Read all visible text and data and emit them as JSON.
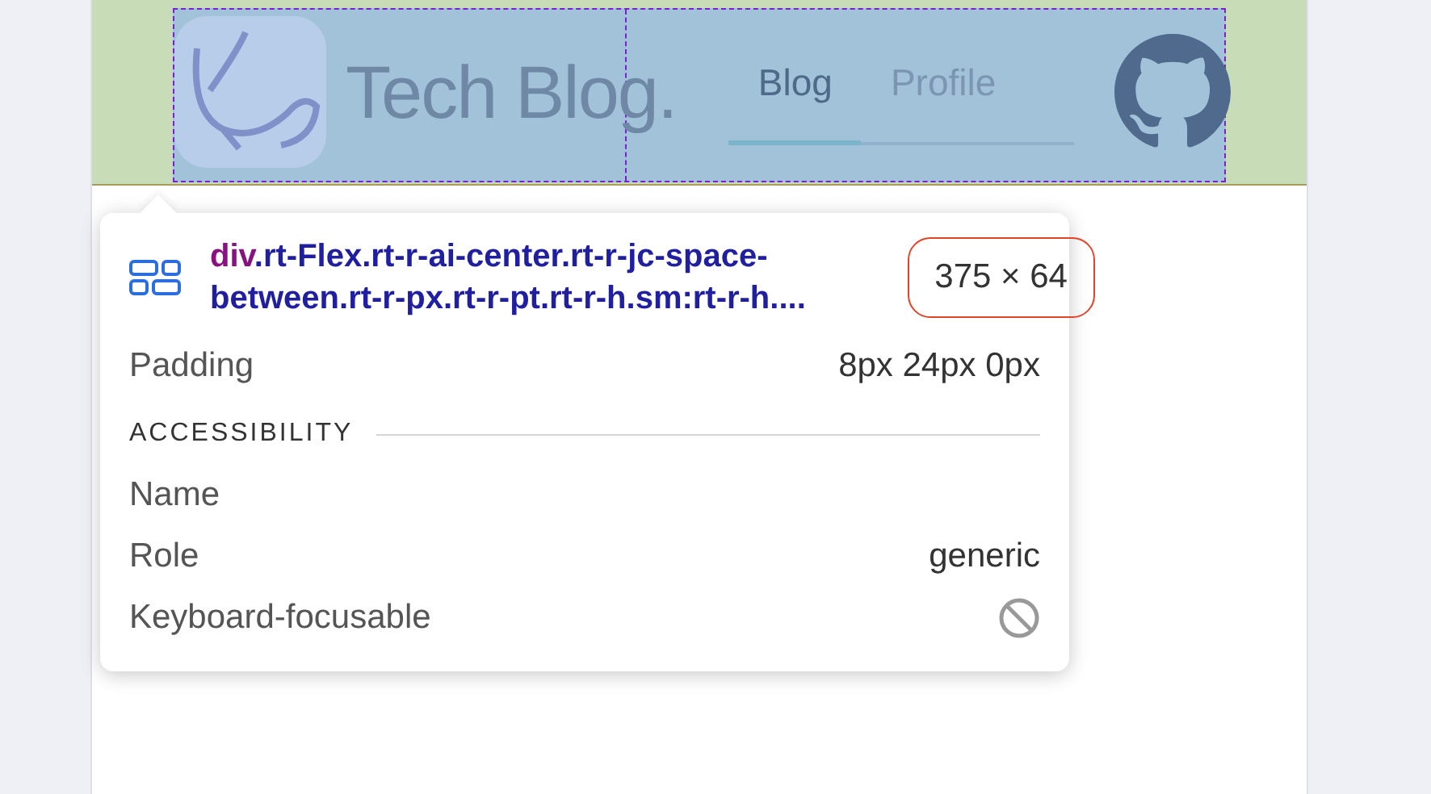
{
  "header": {
    "site_title": "Tech Blog.",
    "nav": [
      {
        "label": "Blog",
        "selected": true
      },
      {
        "label": "Profile",
        "selected": false
      }
    ]
  },
  "inspector": {
    "tag": "div",
    "classes": ".rt-Flex.rt-r-ai-center.rt-r-jc-space-between.rt-r-px.rt-r-pt.rt-r-h.sm:rt-r-h....",
    "size": "375 × 64",
    "box_rows": [
      {
        "label": "Padding",
        "value": "8px 24px 0px"
      }
    ],
    "section": "ACCESSIBILITY",
    "rows": [
      {
        "label": "Name",
        "kind": "text",
        "value": ""
      },
      {
        "label": "Role",
        "kind": "text",
        "value": "generic"
      },
      {
        "label": "Keyboard-focusable",
        "kind": "flag",
        "on": false
      }
    ]
  }
}
